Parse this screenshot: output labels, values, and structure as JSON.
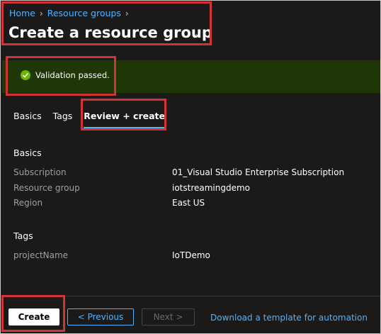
{
  "breadcrumb": [
    {
      "label": "Home"
    },
    {
      "label": "Resource groups"
    }
  ],
  "page": {
    "title": "Create a resource group",
    "more_label": "..."
  },
  "banner": {
    "message": "Validation passed.",
    "status_color": "#6bb700"
  },
  "tabs": [
    {
      "label": "Basics",
      "active": false
    },
    {
      "label": "Tags",
      "active": false
    },
    {
      "label": "Review + create",
      "active": true
    }
  ],
  "basics": {
    "heading": "Basics",
    "rows": [
      {
        "key": "Subscription",
        "value": "01_Visual Studio Enterprise Subscription"
      },
      {
        "key": "Resource group",
        "value": "iotstreamingdemo"
      },
      {
        "key": "Region",
        "value": "East US"
      }
    ]
  },
  "tags": {
    "heading": "Tags",
    "rows": [
      {
        "key": "projectName",
        "value": "IoTDemo"
      }
    ]
  },
  "footer": {
    "create_label": "Create",
    "previous_label": "< Previous",
    "next_label": "Next >",
    "template_link": "Download a template for automation"
  },
  "colors": {
    "accent": "#4fb3ff",
    "highlight_box": "#d13438",
    "banner_bg": "#1f3707"
  }
}
